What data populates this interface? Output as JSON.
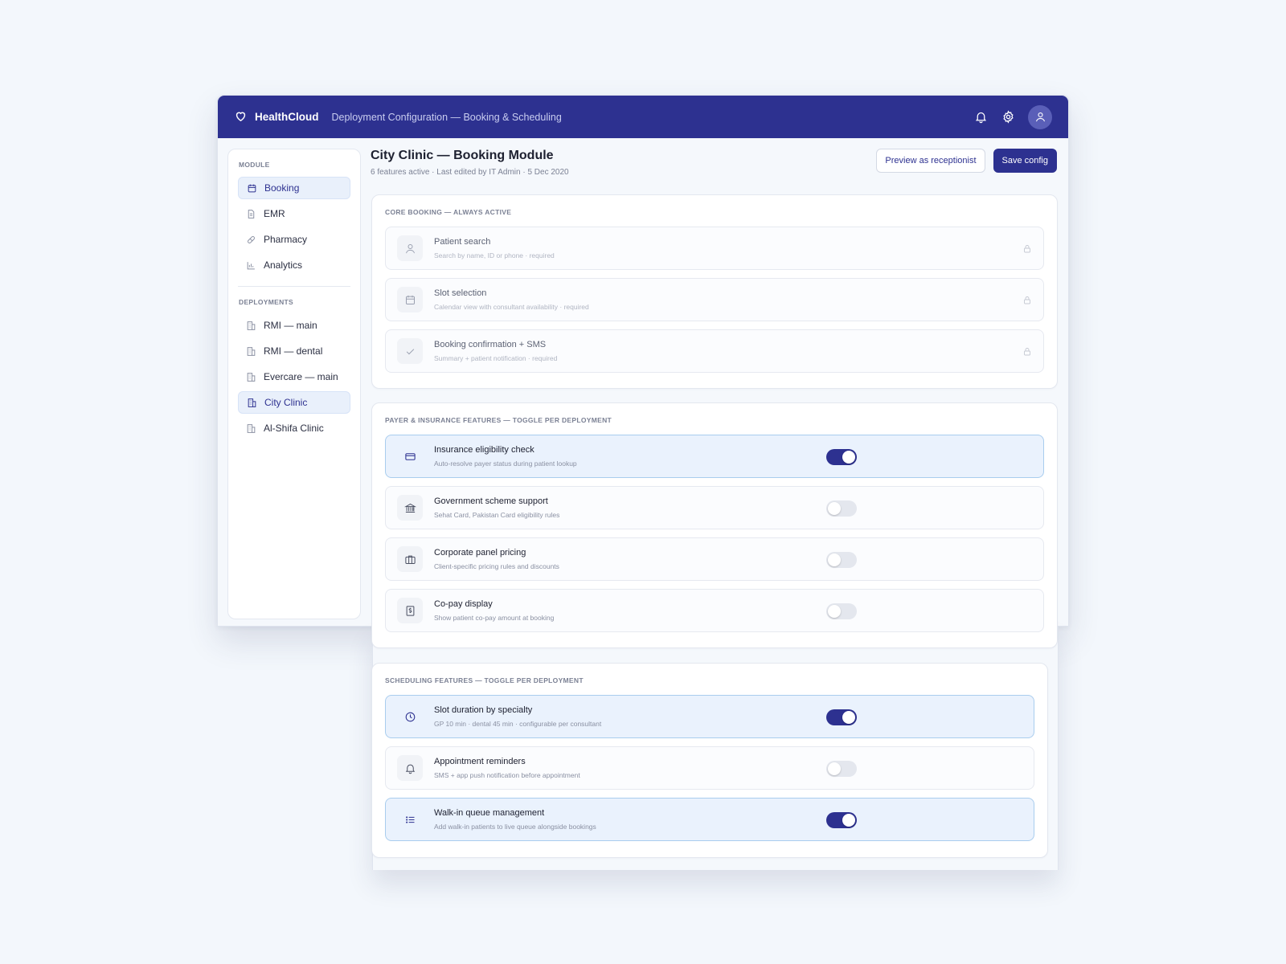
{
  "topbar": {
    "brand": "HealthCloud",
    "subtitle": "Deployment Configuration — Booking & Scheduling",
    "icons": [
      "bell-icon",
      "gear-icon",
      "user-icon"
    ]
  },
  "sidebar": {
    "module_heading": "MODULE",
    "modules": [
      {
        "label": "Booking",
        "icon": "calendar-icon",
        "active": true
      },
      {
        "label": "EMR",
        "icon": "document-icon",
        "active": false
      },
      {
        "label": "Pharmacy",
        "icon": "pill-icon",
        "active": false
      },
      {
        "label": "Analytics",
        "icon": "bar-chart-icon",
        "active": false
      }
    ],
    "deployments_heading": "DEPLOYMENTS",
    "deployments": [
      {
        "label": "RMI — main",
        "icon": "building-icon",
        "active": false
      },
      {
        "label": "RMI — dental",
        "icon": "building-icon",
        "active": false
      },
      {
        "label": "Evercare — main",
        "icon": "building-icon",
        "active": false
      },
      {
        "label": "City Clinic",
        "icon": "building-icon",
        "active": true
      },
      {
        "label": "Al-Shifa Clinic",
        "icon": "building-icon",
        "active": false
      }
    ]
  },
  "page": {
    "title": "City Clinic — Booking Module",
    "meta": "6 features active · Last edited by IT Admin · 5 Dec 2020",
    "preview_label": "Preview as receptionist",
    "save_label": "Save config"
  },
  "core": {
    "title": "CORE BOOKING — ALWAYS ACTIVE",
    "items": [
      {
        "name": "Patient search",
        "desc": "Search by name, ID or phone · required",
        "icon": "user-icon"
      },
      {
        "name": "Slot selection",
        "desc": "Calendar view with consultant availability · required",
        "icon": "calendar-icon"
      },
      {
        "name": "Booking confirmation + SMS",
        "desc": "Summary + patient notification · required",
        "icon": "check-icon"
      }
    ]
  },
  "payer": {
    "title": "PAYER & INSURANCE FEATURES — TOGGLE PER DEPLOYMENT",
    "items": [
      {
        "name": "Insurance eligibility check",
        "desc": "Auto-resolve payer status during patient lookup",
        "icon": "credit-card-icon",
        "enabled": true
      },
      {
        "name": "Government scheme support",
        "desc": "Sehat Card, Pakistan Card eligibility rules",
        "icon": "bank-icon",
        "enabled": false
      },
      {
        "name": "Corporate panel pricing",
        "desc": "Client-specific pricing rules and discounts",
        "icon": "briefcase-icon",
        "enabled": false
      },
      {
        "name": "Co-pay display",
        "desc": "Show patient co-pay amount at booking",
        "icon": "receipt-dollar-icon",
        "enabled": false
      }
    ]
  },
  "scheduling": {
    "title": "SCHEDULING FEATURES — TOGGLE PER DEPLOYMENT",
    "items": [
      {
        "name": "Slot duration by specialty",
        "desc": "GP 10 min · dental 45 min · configurable per consultant",
        "icon": "clock-icon",
        "enabled": true
      },
      {
        "name": "Appointment reminders",
        "desc": "SMS + app push notification before appointment",
        "icon": "bell-icon",
        "enabled": false
      },
      {
        "name": "Walk-in queue management",
        "desc": "Add walk-in patients to live queue alongside bookings",
        "icon": "list-icon",
        "enabled": true
      }
    ]
  },
  "colors": {
    "brand": "#2d3190",
    "active_bg": "#eaf2fd",
    "active_border": "#a9cdee",
    "background": "#f3f7fc"
  }
}
